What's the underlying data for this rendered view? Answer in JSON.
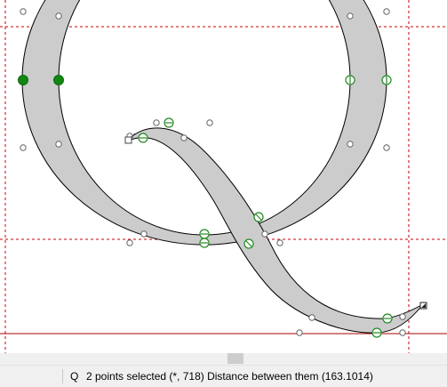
{
  "status_bar": {
    "glyph_name": "Q",
    "message": "2 points selected (*, 718) Distance between them (163.1014)"
  },
  "canvas": {
    "guideline_color": "#cc0000",
    "glyph_fill": "#cccccc",
    "outline_color": "#000000",
    "selected_point_color": "#118811",
    "point_color": "#228822",
    "handle_color": "#888888"
  }
}
